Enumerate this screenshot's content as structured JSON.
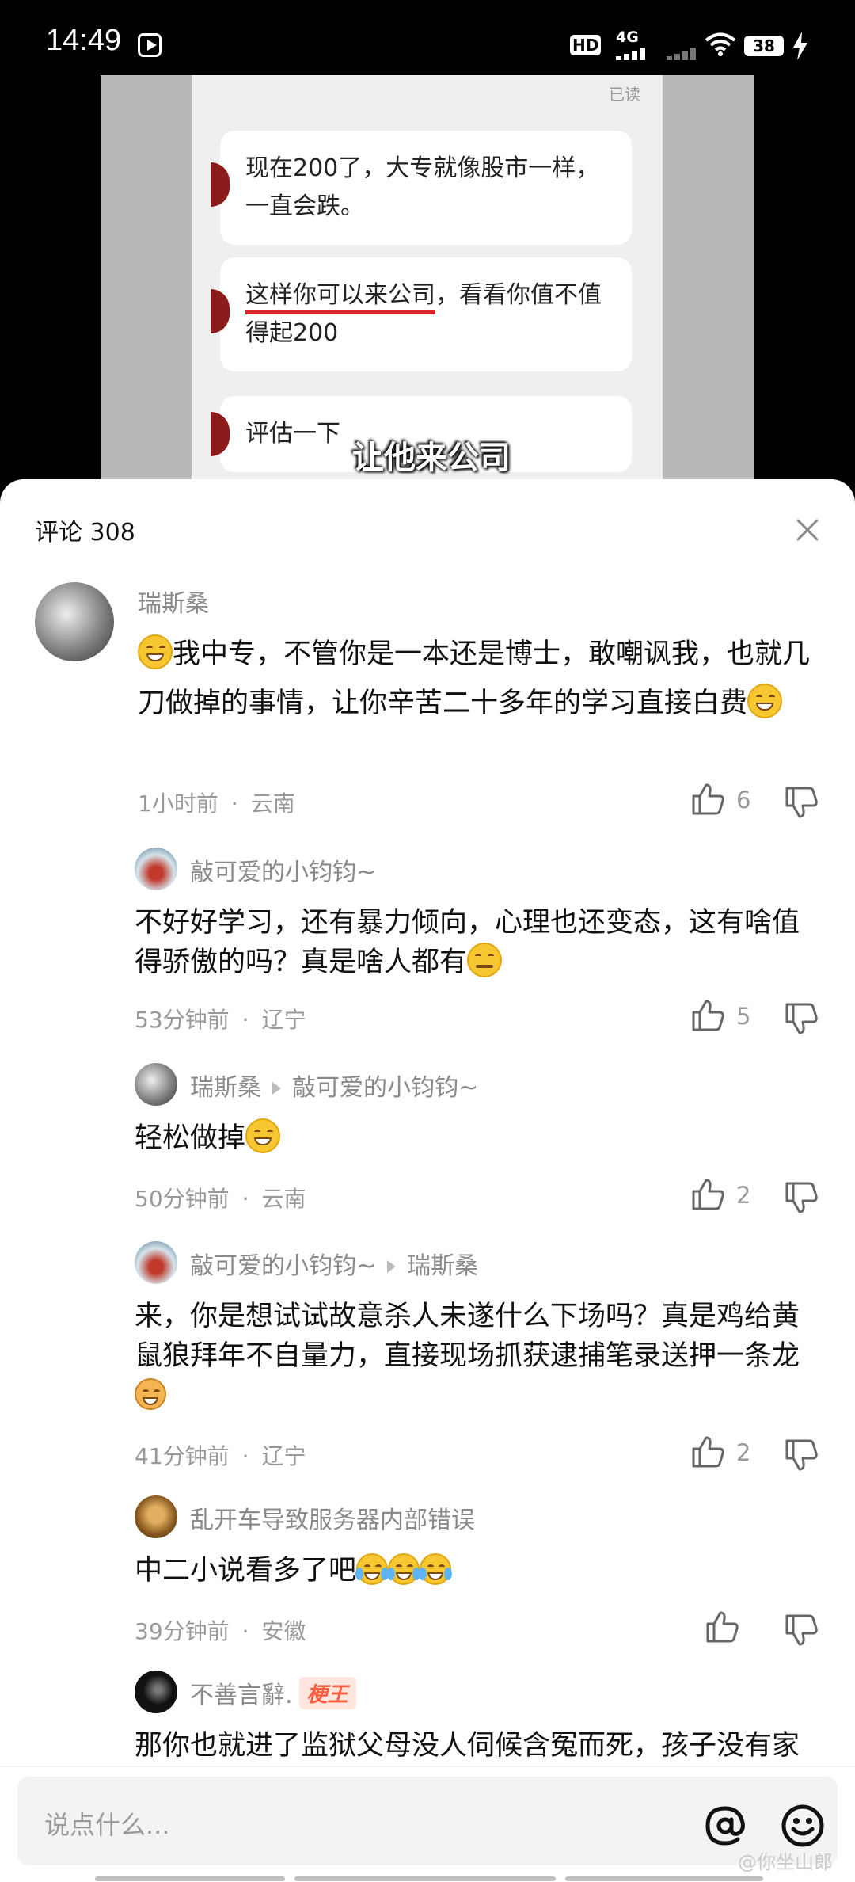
{
  "status_bar": {
    "time": "14:49",
    "network": "4G",
    "hd_label": "HD",
    "battery": "38",
    "icons": [
      "play-icon",
      "hd-icon",
      "signal-icon",
      "wifi-icon",
      "battery-icon",
      "charging-icon"
    ]
  },
  "video": {
    "read_tag": "已读",
    "bubbles": [
      "现在200了，大专就像股市一样，一直会跌。",
      "这样你可以来公司，看看你值不值得起200",
      "评估一下"
    ],
    "underlined_part": "这样你可以来公司",
    "bubble2_rest": "，看看你值不值得起200",
    "caption": "让他来公司"
  },
  "comments_header": {
    "title": "评论 308"
  },
  "comments": [
    {
      "user": "瑞斯桑",
      "text": "我中专，不管你是一本还是博士，敢嘲讽我，也就几刀做掉的事情，让你辛苦二十多年的学习直接白费",
      "time": "1小时前",
      "location": "云南",
      "likes": "6"
    },
    {
      "user": "敲可爱的小钧钧~",
      "text": "不好好学习，还有暴力倾向，心理也还变态，这有啥值得骄傲的吗？真是啥人都有",
      "time": "53分钟前",
      "location": "辽宁",
      "likes": "5"
    },
    {
      "user": "瑞斯桑",
      "reply_to": "敲可爱的小钧钧~",
      "text": "轻松做掉",
      "time": "50分钟前",
      "location": "云南",
      "likes": "2"
    },
    {
      "user": "敲可爱的小钧钧~",
      "reply_to": "瑞斯桑",
      "text": "来，你是想试试故意杀人未遂什么下场吗？真是鸡给黄鼠狼拜年不自量力，直接现场抓获逮捕笔录送押一条龙",
      "time": "41分钟前",
      "location": "辽宁",
      "likes": "2"
    },
    {
      "user": "乱开车导致服务器内部错误",
      "text": "中二小说看多了吧",
      "time": "39分钟前",
      "location": "安徽",
      "likes": ""
    },
    {
      "user": "不善言辭.",
      "badge": "梗王",
      "text": "那你也就进了监狱父母没人伺候含冤而死，孩子没有家教，哈哈哈心理扭曲，这你自己在监狱看"
    }
  ],
  "input": {
    "placeholder": "说点什么...",
    "watermark": "@你坐山郎"
  },
  "colors": {
    "accent_red": "#d7262c",
    "badge_orange": "#ff5a3c",
    "meta_gray": "#999999"
  }
}
